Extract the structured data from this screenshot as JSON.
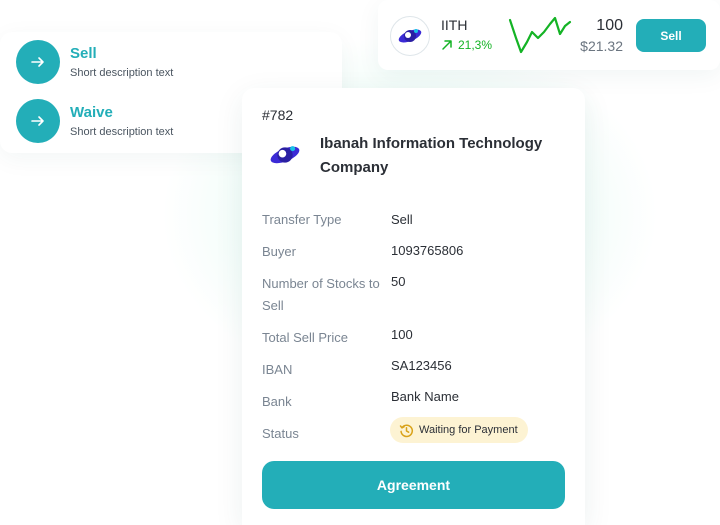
{
  "actions": [
    {
      "title": "Sell",
      "description": "Short description text",
      "icon": "arrow-right-icon"
    },
    {
      "title": "Waive",
      "description": "Short description text",
      "icon": "arrow-right-icon"
    }
  ],
  "ticker": {
    "symbol": "IITH",
    "change": "21,3%",
    "change_icon": "arrow-up-right-icon",
    "quantity": "100",
    "price": "$21.32",
    "sell_label": "Sell",
    "trend_color": "#14b325"
  },
  "order": {
    "id": "#782",
    "company": "Ibanah Information Technology Company",
    "fields": [
      {
        "label": "Transfer Type",
        "value": "Sell"
      },
      {
        "label": "Buyer",
        "value": "1093765806"
      },
      {
        "label": "Number of Stocks to Sell",
        "value": "50"
      },
      {
        "label": "Total Sell Price",
        "value": "100"
      },
      {
        "label": "IBAN",
        "value": "SA123456"
      },
      {
        "label": "Bank",
        "value": "Bank Name"
      },
      {
        "label": "Status",
        "value": "Waiting for Payment"
      }
    ],
    "status_icon": "clock-history-icon",
    "agreement_label": "Agreement"
  },
  "colors": {
    "accent": "#23aeb8",
    "positive": "#14b325",
    "status_bg": "#fdf3d3",
    "status_icon": "#d9a219"
  }
}
